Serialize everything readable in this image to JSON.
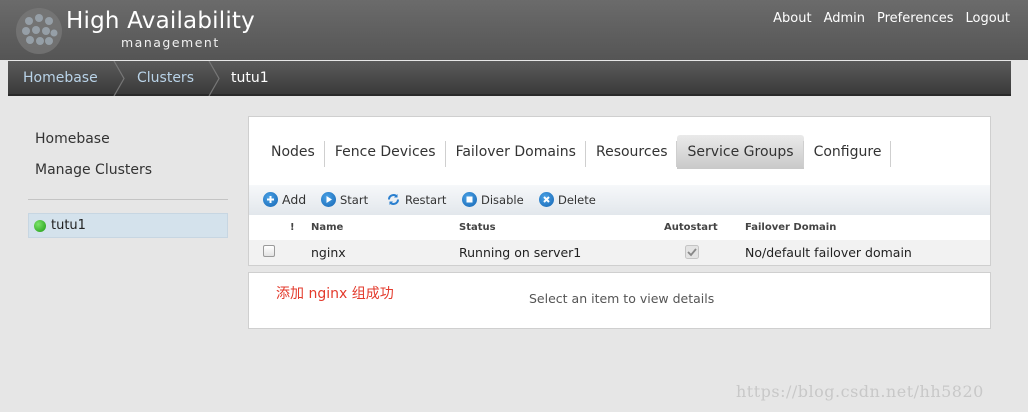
{
  "header": {
    "title": "High Availability",
    "subtitle": "management",
    "nav": [
      "About",
      "Admin",
      "Preferences",
      "Logout"
    ]
  },
  "breadcrumb": {
    "items": [
      "Homebase",
      "Clusters"
    ],
    "current": "tutu1"
  },
  "sidebar": {
    "links": [
      "Homebase",
      "Manage Clusters"
    ],
    "cluster": {
      "name": "tutu1",
      "status_color": "#2aa81a"
    }
  },
  "tabs": {
    "items": [
      "Nodes",
      "Fence Devices",
      "Failover Domains",
      "Resources",
      "Service Groups",
      "Configure"
    ],
    "active": "Service Groups"
  },
  "toolbar": {
    "add": "Add",
    "start": "Start",
    "restart": "Restart",
    "disable": "Disable",
    "delete": "Delete"
  },
  "table": {
    "columns": {
      "warn": "!",
      "name": "Name",
      "status": "Status",
      "autostart": "Autostart",
      "failover": "Failover Domain"
    },
    "rows": [
      {
        "name": "nginx",
        "status": "Running on server1",
        "autostart": true,
        "failover": "No/default failover domain"
      }
    ]
  },
  "details": {
    "annotation": "添加 nginx 组成功",
    "empty_message": "Select an item to view details"
  },
  "watermark": "https://blog.csdn.net/hh5820"
}
